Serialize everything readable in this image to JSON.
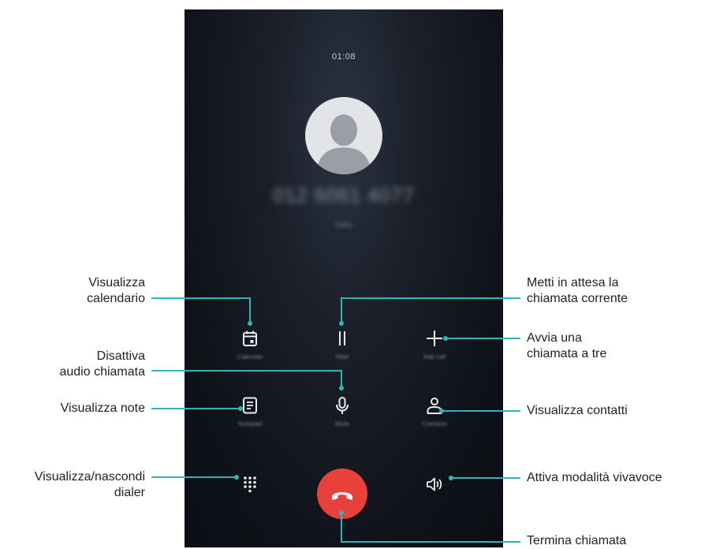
{
  "call": {
    "timer": "01:08",
    "number": "012 6061 4077",
    "location": "Italia"
  },
  "buttons": {
    "calendar": "Calendar",
    "hold": "Hold",
    "add_call": "Add call",
    "notepad": "Notepad",
    "mute": "Mute",
    "contacts": "Contacts"
  },
  "callouts": {
    "visualizza_calendario": "Visualizza\ncalendario",
    "disattiva_audio": "Disattiva\naudio chiamata",
    "visualizza_note": "Visualizza note",
    "visualizza_dialer": "Visualizza/nascondi\ndialer",
    "metti_in_attesa": "Metti in attesa la\nchiamata corrente",
    "avvia_tre": "Avvia una\nchiamata a tre",
    "visualizza_contatti": "Visualizza contatti",
    "vivavoce": "Attiva modalità vivavoce",
    "termina": "Termina chiamata"
  },
  "colors": {
    "end_call_red": "#e8403a",
    "callout_line": "#33b5b5",
    "icon": "#e9ebef"
  },
  "icons": [
    "person-icon",
    "calendar-icon",
    "pause-icon",
    "plus-icon",
    "notepad-icon",
    "microphone-icon",
    "contact-icon",
    "dialpad-icon",
    "phone-hangup-icon",
    "speaker-icon"
  ]
}
